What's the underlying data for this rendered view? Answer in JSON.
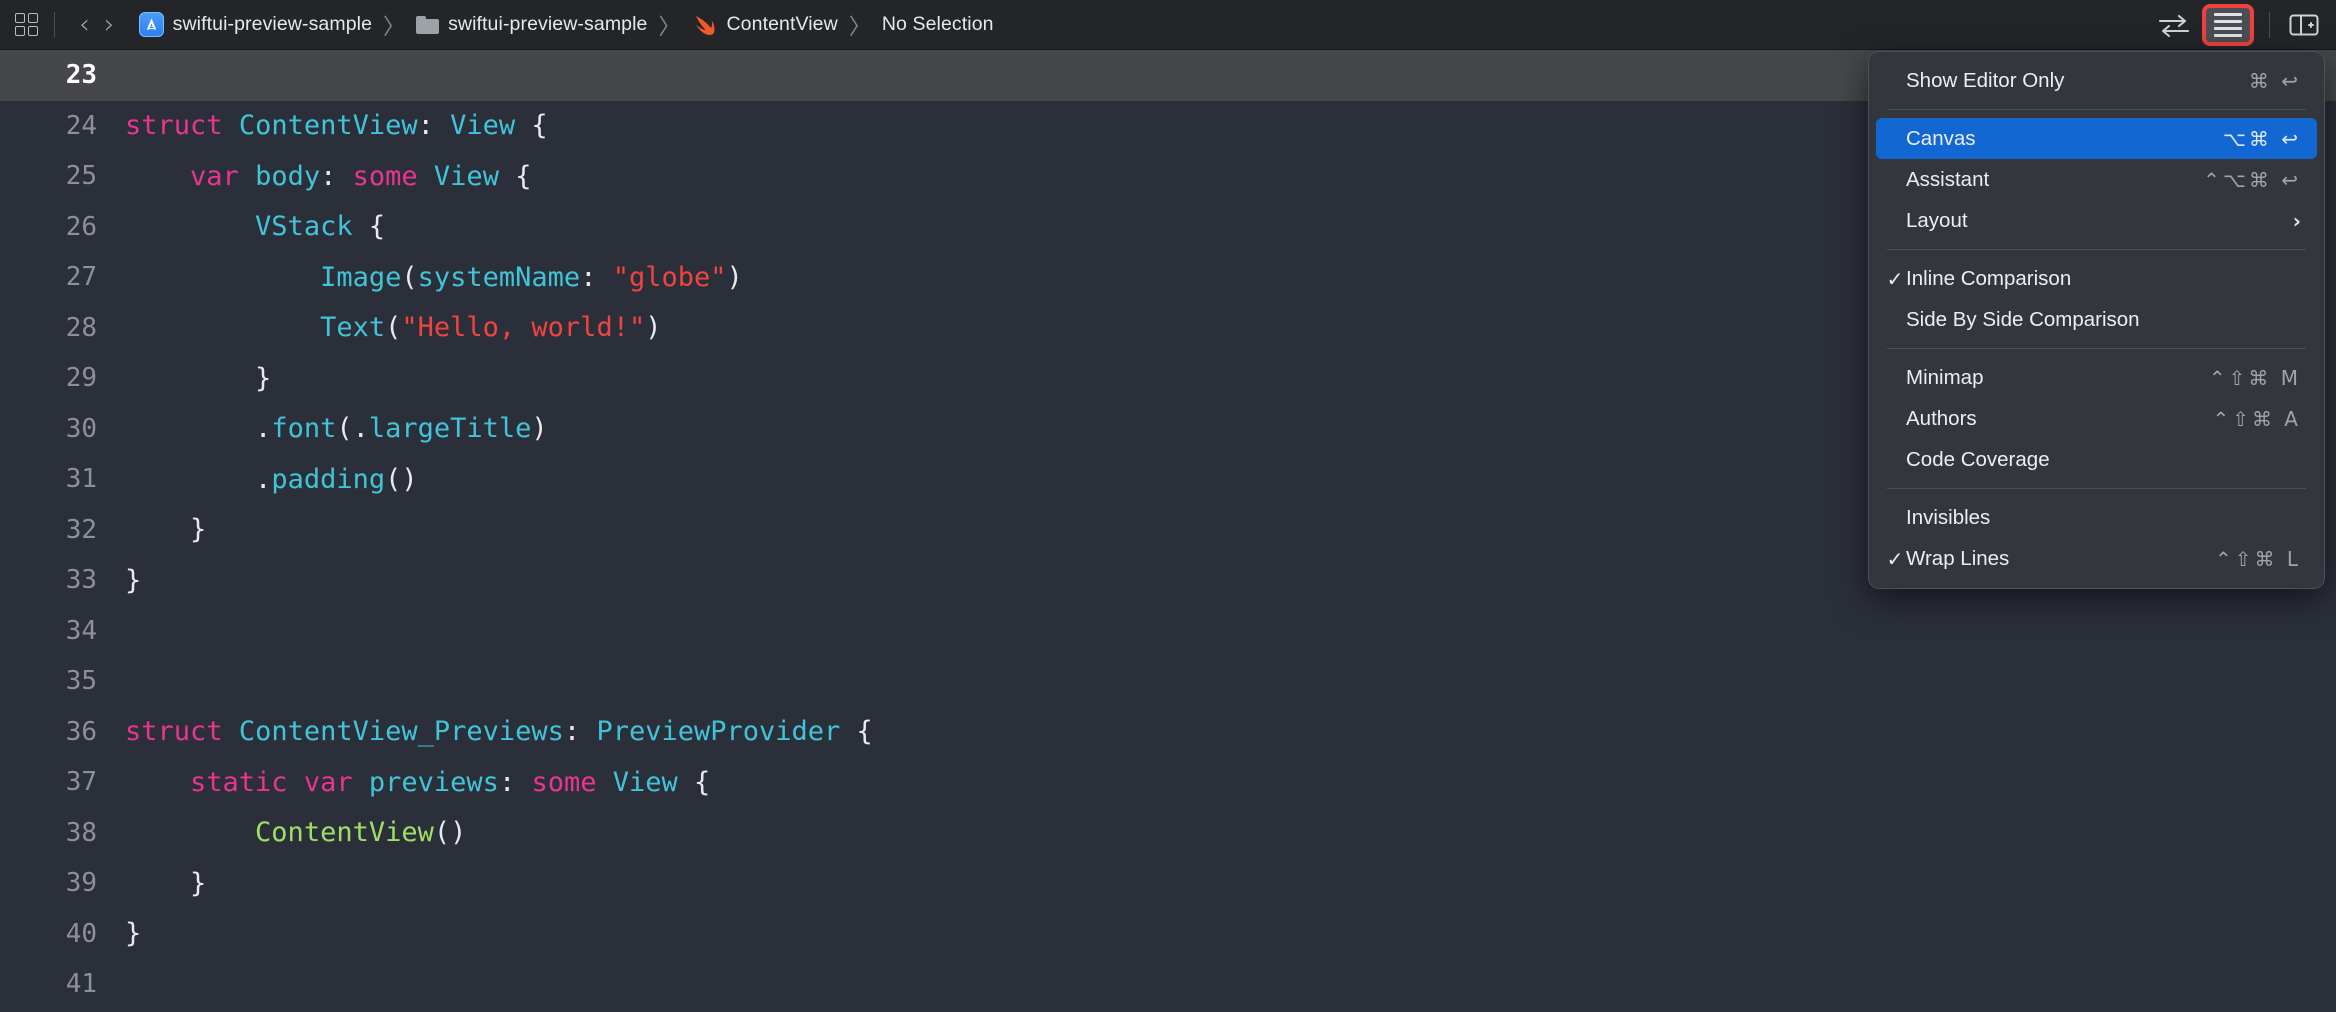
{
  "toolbar": {
    "grid_icon": "grid-squares-icon",
    "back_icon": "chevron-left-icon",
    "forward_icon": "chevron-right-icon",
    "back_glyph": "‹",
    "forward_glyph": "›",
    "separator_glyph": "〉",
    "breadcrumbs": [
      {
        "icon": "xcode-project-icon",
        "label": "swiftui-preview-sample"
      },
      {
        "icon": "folder-icon",
        "label": "swiftui-preview-sample"
      },
      {
        "icon": "swift-file-icon",
        "label": "ContentView"
      },
      {
        "icon": "none",
        "label": "No Selection"
      }
    ],
    "swap_icon": "swap-arrows-icon",
    "editor_options_icon": "editor-lines-icon",
    "inspector_icon": "toggle-inspector-icon",
    "highlight_color": "#f2403f"
  },
  "editor": {
    "active_line": 23,
    "lines": [
      {
        "num": "23",
        "tokens": []
      },
      {
        "num": "24",
        "tokens": [
          {
            "t": "kw",
            "s": "struct"
          },
          {
            "t": "pun",
            "s": " "
          },
          {
            "t": "type",
            "s": "ContentView"
          },
          {
            "t": "pun",
            "s": ": "
          },
          {
            "t": "type",
            "s": "View"
          },
          {
            "t": "pun",
            "s": " {"
          }
        ]
      },
      {
        "num": "25",
        "tokens": [
          {
            "t": "pun",
            "s": "    "
          },
          {
            "t": "kw",
            "s": "var"
          },
          {
            "t": "pun",
            "s": " "
          },
          {
            "t": "mem",
            "s": "body"
          },
          {
            "t": "pun",
            "s": ": "
          },
          {
            "t": "kw",
            "s": "some"
          },
          {
            "t": "pun",
            "s": " "
          },
          {
            "t": "type",
            "s": "View"
          },
          {
            "t": "pun",
            "s": " {"
          }
        ]
      },
      {
        "num": "26",
        "tokens": [
          {
            "t": "pun",
            "s": "        "
          },
          {
            "t": "type",
            "s": "VStack"
          },
          {
            "t": "pun",
            "s": " {"
          }
        ]
      },
      {
        "num": "27",
        "tokens": [
          {
            "t": "pun",
            "s": "            "
          },
          {
            "t": "type",
            "s": "Image"
          },
          {
            "t": "pun",
            "s": "("
          },
          {
            "t": "mem",
            "s": "systemName"
          },
          {
            "t": "pun",
            "s": ": "
          },
          {
            "t": "str",
            "s": "\"globe\""
          },
          {
            "t": "pun",
            "s": ")"
          }
        ]
      },
      {
        "num": "28",
        "tokens": [
          {
            "t": "pun",
            "s": "            "
          },
          {
            "t": "type",
            "s": "Text"
          },
          {
            "t": "pun",
            "s": "("
          },
          {
            "t": "str",
            "s": "\"Hello, world!\""
          },
          {
            "t": "pun",
            "s": ")"
          }
        ]
      },
      {
        "num": "29",
        "tokens": [
          {
            "t": "pun",
            "s": "        }"
          }
        ]
      },
      {
        "num": "30",
        "tokens": [
          {
            "t": "pun",
            "s": "        ."
          },
          {
            "t": "mem",
            "s": "font"
          },
          {
            "t": "pun",
            "s": "(."
          },
          {
            "t": "mem",
            "s": "largeTitle"
          },
          {
            "t": "pun",
            "s": ")"
          }
        ]
      },
      {
        "num": "31",
        "tokens": [
          {
            "t": "pun",
            "s": "        ."
          },
          {
            "t": "mem",
            "s": "padding"
          },
          {
            "t": "pun",
            "s": "()"
          }
        ]
      },
      {
        "num": "32",
        "tokens": [
          {
            "t": "pun",
            "s": "    }"
          }
        ]
      },
      {
        "num": "33",
        "tokens": [
          {
            "t": "pun",
            "s": "}"
          }
        ]
      },
      {
        "num": "34",
        "tokens": []
      },
      {
        "num": "35",
        "tokens": []
      },
      {
        "num": "36",
        "tokens": [
          {
            "t": "kw",
            "s": "struct"
          },
          {
            "t": "pun",
            "s": " "
          },
          {
            "t": "type",
            "s": "ContentView_Previews"
          },
          {
            "t": "pun",
            "s": ": "
          },
          {
            "t": "type",
            "s": "PreviewProvider"
          },
          {
            "t": "pun",
            "s": " {"
          }
        ]
      },
      {
        "num": "37",
        "tokens": [
          {
            "t": "pun",
            "s": "    "
          },
          {
            "t": "kw",
            "s": "static"
          },
          {
            "t": "pun",
            "s": " "
          },
          {
            "t": "kw",
            "s": "var"
          },
          {
            "t": "pun",
            "s": " "
          },
          {
            "t": "mem",
            "s": "previews"
          },
          {
            "t": "pun",
            "s": ": "
          },
          {
            "t": "kw",
            "s": "some"
          },
          {
            "t": "pun",
            "s": " "
          },
          {
            "t": "type",
            "s": "View"
          },
          {
            "t": "pun",
            "s": " {"
          }
        ]
      },
      {
        "num": "38",
        "tokens": [
          {
            "t": "pun",
            "s": "        "
          },
          {
            "t": "proj",
            "s": "ContentView"
          },
          {
            "t": "pun",
            "s": "()"
          }
        ]
      },
      {
        "num": "39",
        "tokens": [
          {
            "t": "pun",
            "s": "    }"
          }
        ]
      },
      {
        "num": "40",
        "tokens": [
          {
            "t": "pun",
            "s": "}"
          }
        ]
      },
      {
        "num": "41",
        "tokens": []
      }
    ],
    "colors": {
      "background": "#2b2f3a",
      "active_line": "#45474a",
      "keyword": "#e8368f",
      "type": "#41c4d8",
      "string": "#f0443e",
      "project_symbol": "#9ee066",
      "punctuation": "#e8eaec",
      "line_number": "#8d9097"
    }
  },
  "menu": {
    "accent_color": "#1267d2",
    "background": "#33363d",
    "items": [
      {
        "kind": "item",
        "label": "Show Editor Only",
        "checked": false,
        "shortcut": "⌘ ↩",
        "submenu": false
      },
      {
        "kind": "separator"
      },
      {
        "kind": "item",
        "label": "Canvas",
        "checked": false,
        "shortcut": "⌥⌘ ↩",
        "submenu": false,
        "selected": true
      },
      {
        "kind": "item",
        "label": "Assistant",
        "checked": false,
        "shortcut": "⌃⌥⌘ ↩",
        "submenu": false
      },
      {
        "kind": "item",
        "label": "Layout",
        "checked": false,
        "shortcut": "",
        "submenu": true
      },
      {
        "kind": "separator"
      },
      {
        "kind": "item",
        "label": "Inline Comparison",
        "checked": true,
        "shortcut": "",
        "submenu": false
      },
      {
        "kind": "item",
        "label": "Side By Side Comparison",
        "checked": false,
        "shortcut": "",
        "submenu": false
      },
      {
        "kind": "separator"
      },
      {
        "kind": "item",
        "label": "Minimap",
        "checked": false,
        "shortcut": "⌃⇧⌘ M",
        "submenu": false
      },
      {
        "kind": "item",
        "label": "Authors",
        "checked": false,
        "shortcut": "⌃⇧⌘ A",
        "submenu": false
      },
      {
        "kind": "item",
        "label": "Code Coverage",
        "checked": false,
        "shortcut": "",
        "submenu": false
      },
      {
        "kind": "separator"
      },
      {
        "kind": "item",
        "label": "Invisibles",
        "checked": false,
        "shortcut": "",
        "submenu": false
      },
      {
        "kind": "item",
        "label": "Wrap Lines",
        "checked": true,
        "shortcut": "⌃⇧⌘ L",
        "submenu": false
      }
    ],
    "check_glyph": "✓",
    "submenu_glyph": "›"
  }
}
